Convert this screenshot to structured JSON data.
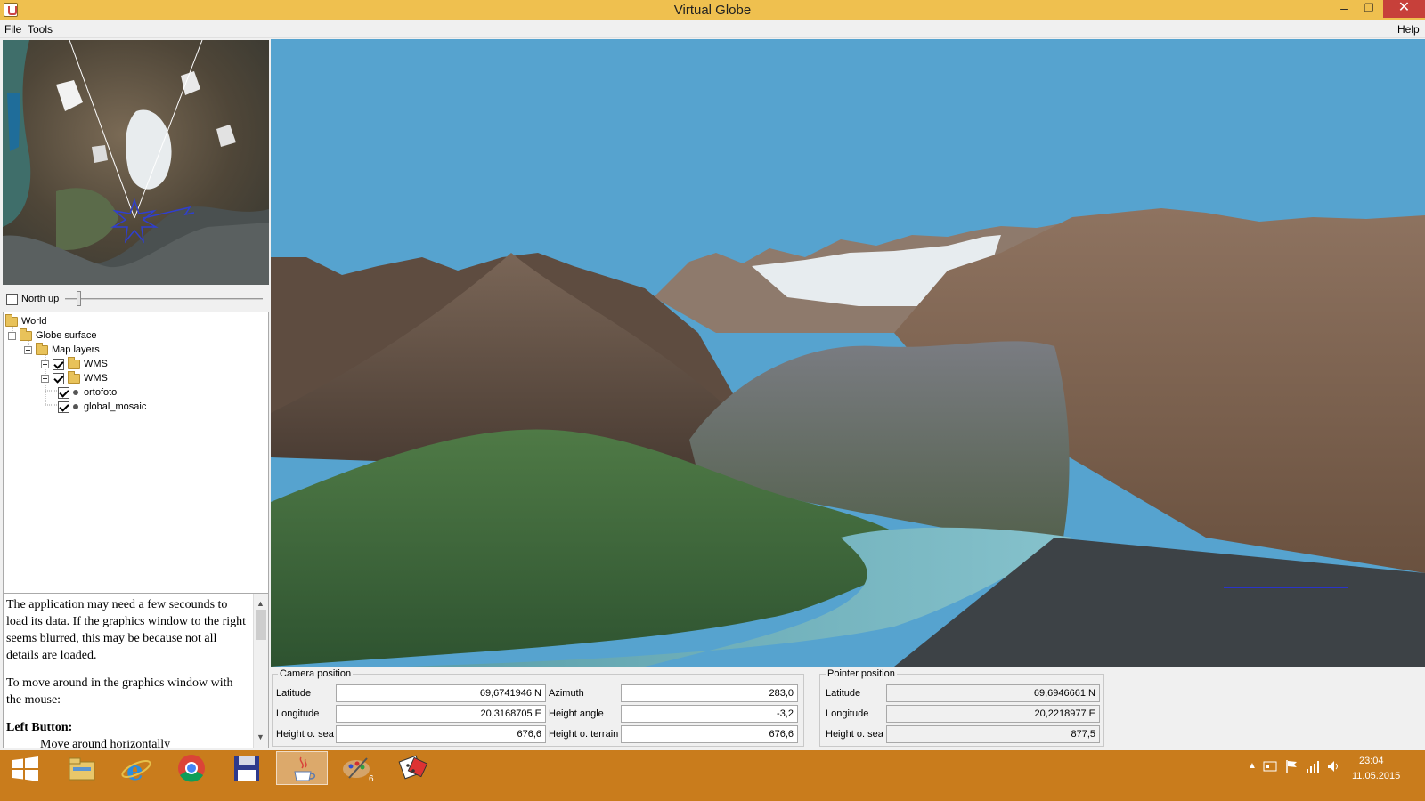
{
  "window": {
    "title": "Virtual Globe",
    "minimize": "–",
    "maximize": "❐",
    "close": "✕"
  },
  "menu": {
    "file": "File",
    "tools": "Tools",
    "help": "Help"
  },
  "minimap": {
    "north_up_label": "North up",
    "north_up_checked": false
  },
  "tree": {
    "items": [
      {
        "label": "World",
        "type": "folder",
        "level": 0
      },
      {
        "label": "Globe surface",
        "type": "folder",
        "level": 1,
        "expanded": true
      },
      {
        "label": "Map layers",
        "type": "folder",
        "level": 2,
        "expanded": true
      },
      {
        "label": "WMS",
        "type": "folder",
        "level": 3,
        "checked": true
      },
      {
        "label": "WMS",
        "type": "folder",
        "level": 3,
        "checked": true
      },
      {
        "label": "ortofoto",
        "type": "layer",
        "level": 3,
        "checked": true
      },
      {
        "label": "global_mosaic",
        "type": "layer",
        "level": 3,
        "checked": true
      }
    ]
  },
  "help": {
    "p1": "The application may need a few secounds to load its data. If the graphics window to the right seems blurred, this may be because not all details are loaded.",
    "p2": "To move around in the graphics window with the mouse:",
    "heading": "Left Button:",
    "item": "Move around horizontally"
  },
  "camera": {
    "title": "Camera position",
    "latitude_label": "Latitude",
    "latitude": "69,6741946 N",
    "longitude_label": "Longitude",
    "longitude": "20,3168705 E",
    "height_sea_label": "Height o. sea",
    "height_sea": "676,6",
    "azimuth_label": "Azimuth",
    "azimuth": "283,0",
    "height_angle_label": "Height angle",
    "height_angle": "-3,2",
    "height_terrain_label": "Height o. terrain",
    "height_terrain": "676,6"
  },
  "pointer": {
    "title": "Pointer position",
    "latitude_label": "Latitude",
    "latitude": "69,6946661 N",
    "longitude_label": "Longitude",
    "longitude": "20,2218977 E",
    "height_sea_label": "Height o. sea",
    "height_sea": "877,5"
  },
  "taskbar": {
    "badge": "6",
    "time": "23:04",
    "date": "11.05.2015",
    "icons": [
      "windows-start-icon",
      "file-explorer-icon",
      "internet-explorer-icon",
      "chrome-icon",
      "save-disk-icon",
      "java-icon",
      "paint-icon",
      "dice-icon"
    ]
  },
  "colors": {
    "titlebar": "#efc04f",
    "taskbar": "#c97c1c",
    "sky": "#56a3cf",
    "close": "#c7403a"
  }
}
